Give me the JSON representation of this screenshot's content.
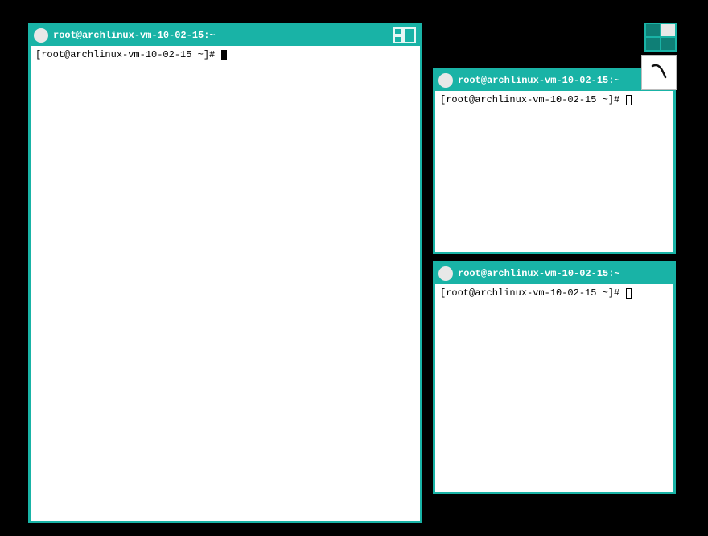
{
  "colors": {
    "accent": "#19b3a6"
  },
  "pager": {
    "active_cell": 1
  },
  "tool_tile": {
    "icon_name": "terminal-icon"
  },
  "windows": [
    {
      "id": "win1",
      "title": "root@archlinux-vm-10-02-15:~",
      "prompt": "[root@archlinux-vm-10-02-15 ~]# ",
      "cursor": "filled",
      "focused": true
    },
    {
      "id": "win2",
      "title": "root@archlinux-vm-10-02-15:~",
      "prompt": "[root@archlinux-vm-10-02-15 ~]# ",
      "cursor": "hollow",
      "focused": false
    },
    {
      "id": "win3",
      "title": "root@archlinux-vm-10-02-15:~",
      "prompt": "[root@archlinux-vm-10-02-15 ~]# ",
      "cursor": "hollow",
      "focused": false
    }
  ]
}
